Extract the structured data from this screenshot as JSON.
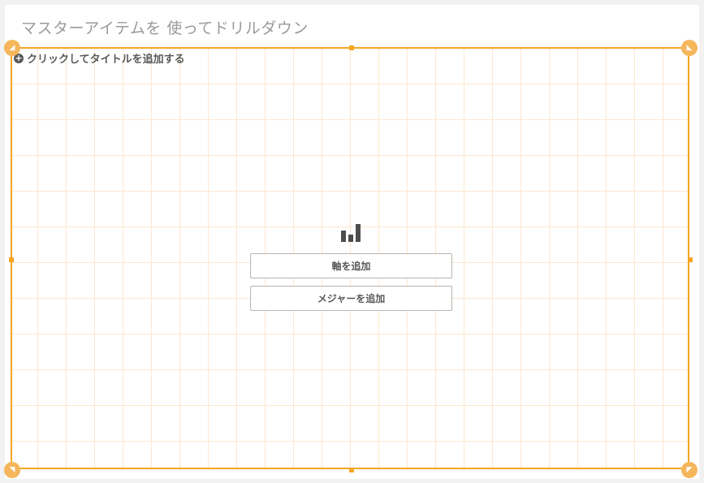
{
  "sheet": {
    "title": "マスターアイテムを 使ってドリルダウン"
  },
  "chart_object": {
    "add_title_label": "クリックしてタイトルを追加する",
    "add_dimension_label": "軸を追加",
    "add_measure_label": "メジャーを追加",
    "chart_icon": "bar-chart-icon"
  },
  "colors": {
    "selection_frame": "#f5a623",
    "grid_line": "#fde7cf",
    "title_text": "#9a9a9a",
    "button_text": "#595959"
  }
}
